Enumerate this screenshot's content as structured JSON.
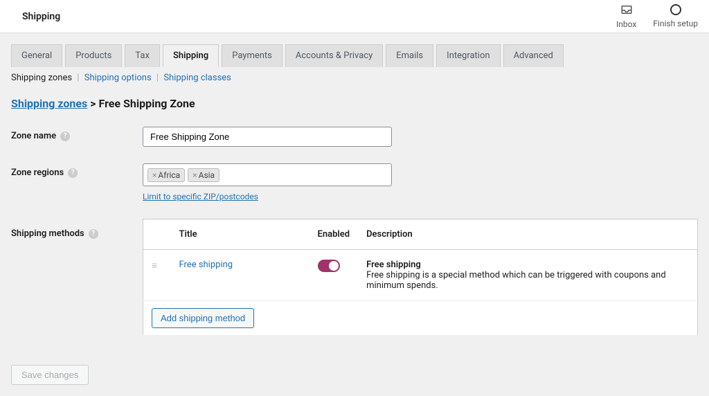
{
  "header": {
    "title": "Shipping",
    "inbox_label": "Inbox",
    "finish_label": "Finish setup"
  },
  "tabs": [
    "General",
    "Products",
    "Tax",
    "Shipping",
    "Payments",
    "Accounts & Privacy",
    "Emails",
    "Integration",
    "Advanced"
  ],
  "active_tab": "Shipping",
  "subtabs": {
    "zones": "Shipping zones",
    "options": "Shipping options",
    "classes": "Shipping classes"
  },
  "breadcrumb": {
    "root": "Shipping zones",
    "sep": ">",
    "current": "Free Shipping Zone"
  },
  "labels": {
    "zone_name": "Zone name",
    "zone_regions": "Zone regions",
    "shipping_methods": "Shipping methods",
    "zip_link": "Limit to specific ZIP/postcodes",
    "help": "?"
  },
  "zone_name_value": "Free Shipping Zone",
  "zone_regions": [
    "Africa",
    "Asia"
  ],
  "table": {
    "headers": {
      "title": "Title",
      "enabled": "Enabled",
      "description": "Description"
    },
    "rows": [
      {
        "title": "Free shipping",
        "enabled": true,
        "desc_title": "Free shipping",
        "desc_text": "Free shipping is a special method which can be triggered with coupons and minimum spends."
      }
    ],
    "add_button": "Add shipping method"
  },
  "save_button": "Save changes"
}
